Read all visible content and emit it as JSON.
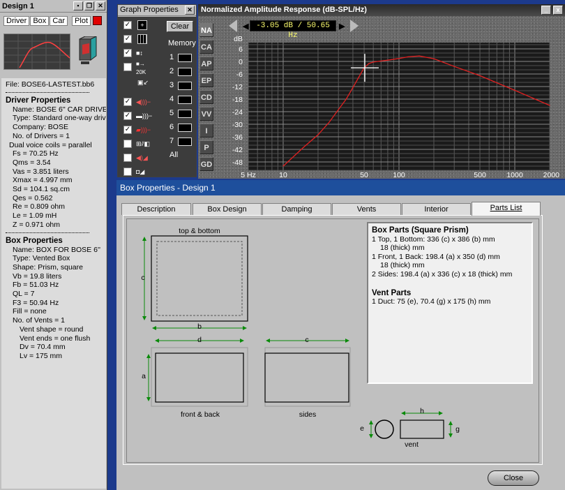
{
  "design_window": {
    "title": "Design 1",
    "tabs": [
      "Driver",
      "Box",
      "Car",
      "Plot"
    ],
    "file": "File:  BOSE6-LASTEST.bb6",
    "driver_header": "Driver Properties",
    "driver_lines": [
      "Name: BOSE 6'' CAR DRIVE",
      "Type: Standard one-way driv",
      "Company: BOSE",
      "No. of Drivers = 1",
      "Dual voice coils = parallel",
      "Fs =  70.25 Hz",
      "Qms =  3.54",
      "Vas =  3.851 liters",
      "Xmax =  4.997 mm",
      "Sd =  104.1 sq.cm",
      "Qes =  0.562",
      "Re =  0.809 ohm",
      "Le =  1.09 mH",
      "Z =  0.971 ohm"
    ],
    "box_header": "Box Properties",
    "box_lines": [
      "Name: BOX FOR BOSE 6''",
      "Type: Vented Box",
      "Shape: Prism, square",
      "Vb =  19.8 liters",
      "Fb =  51.03 Hz",
      "QL =  7",
      "F3 =  50.94 Hz",
      "Fill = none",
      "No. of Vents = 1"
    ],
    "vent_lines": [
      "Vent shape = round",
      "Vent ends = one flush",
      "Dv =  70.4 mm",
      "Lv =  175 mm"
    ]
  },
  "graph_properties": {
    "title": "Graph Properties",
    "clear_label": "Clear",
    "memory_label": "Memory",
    "memory_slots": [
      "1",
      "2",
      "3",
      "4",
      "5",
      "6",
      "7"
    ],
    "all_label": "All",
    "icon_20k": "20K"
  },
  "graph_window": {
    "title": "Normalized Amplitude Response (dB-SPL/Hz)",
    "readout": "-3.05 dB / 50.65 Hz",
    "side_buttons": [
      "NA",
      "CA",
      "AP",
      "EP",
      "CD",
      "VV",
      "I",
      "P",
      "GD"
    ],
    "close_icon": "x",
    "min_icon": "_"
  },
  "chart_data": {
    "type": "line",
    "ylabel": "dB",
    "ytick_labels": [
      "6",
      "0",
      "-6",
      "-12",
      "-18",
      "-24",
      "-30",
      "-36",
      "-42",
      "-48"
    ],
    "xtick_labels": [
      "5 Hz",
      "10",
      "50",
      "100",
      "500",
      "1000",
      "2000"
    ],
    "xtick_values": [
      5,
      10,
      50,
      100,
      500,
      1000,
      2000
    ],
    "ylim": [
      -52,
      9
    ],
    "xlim": [
      5,
      2000
    ],
    "xscale": "log",
    "grid": true,
    "series": [
      {
        "color": "#e02020",
        "x": [
          10,
          15,
          20,
          25,
          30,
          35,
          40,
          45,
          50,
          55,
          60,
          70,
          80,
          100,
          120,
          150,
          200,
          300,
          500,
          1000,
          2000
        ],
        "y": [
          -50,
          -41,
          -35,
          -29,
          -23,
          -18,
          -12.5,
          -7.5,
          -3.05,
          -1,
          -0.3,
          0.2,
          0.6,
          1.4,
          2.2,
          2.6,
          1.3,
          -2.4,
          -6.8,
          -13.8,
          -21
        ]
      }
    ],
    "cursor": {
      "x": 50.65,
      "y": -3.05
    }
  },
  "box_properties": {
    "title": "Box Properties - Design 1",
    "tabs": [
      "Description",
      "Box Design",
      "Damping",
      "Vents",
      "Interior",
      "Parts List"
    ],
    "active_tab": "Parts List",
    "diagram": {
      "top_bottom_label": "top & bottom",
      "front_back_label": "front & back",
      "sides_label": "sides",
      "vent_label": "vent",
      "dims": {
        "a": "a",
        "b": "b",
        "c": "c",
        "d": "d",
        "e": "e",
        "g": "g",
        "h": "h"
      }
    },
    "parts": {
      "box_header": "Box Parts (Square Prism)",
      "box_lines": [
        "1 Top, 1 Bottom:  336 (c) x 386 (b) mm",
        "18 (thick) mm",
        "1 Front, 1 Back:  198.4 (a) x 350 (d) mm",
        "18 (thick) mm",
        "2 Sides:  198.4 (a) x 336 (c) x 18 (thick) mm"
      ],
      "vent_header": "Vent Parts",
      "vent_lines": [
        "1 Duct:  75 (e), 70.4 (g) x 175 (h) mm"
      ]
    },
    "close_label": "Close"
  },
  "colors": {
    "desktop": "#1c3a8c",
    "curve": "#e02020",
    "dimension_lines": "#0a8a0a",
    "box_title_bar": "#1e4f9c"
  }
}
